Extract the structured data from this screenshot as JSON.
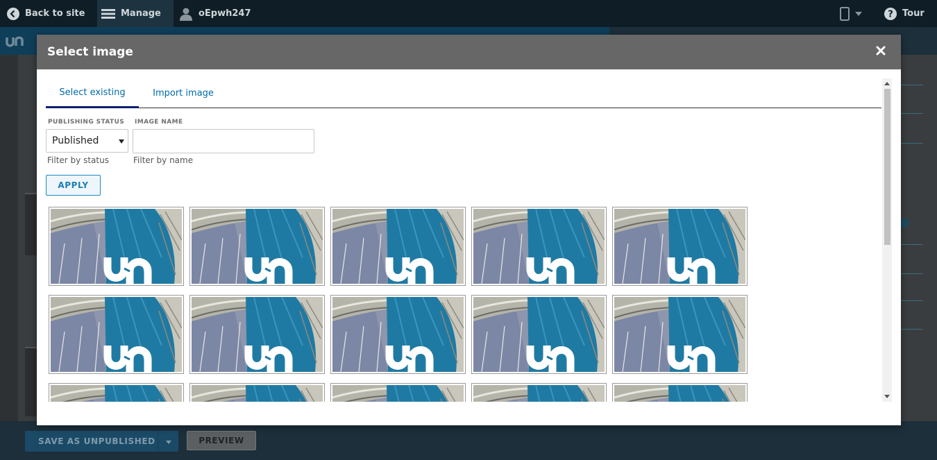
{
  "toolbar": {
    "back_label": "Back to site",
    "manage_label": "Manage",
    "user_label": "oEpwh247",
    "tour_label": "Tour"
  },
  "modal": {
    "title": "Select image",
    "tabs": [
      {
        "label": "Select existing",
        "active": true
      },
      {
        "label": "Import image",
        "active": false
      }
    ],
    "filters": {
      "status_label": "PUBLISHING STATUS",
      "status_value": "Published",
      "status_help": "Filter by status",
      "name_label": "IMAGE NAME",
      "name_value": "",
      "name_help": "Filter by name",
      "apply_label": "APPLY"
    }
  },
  "footer": {
    "save_label": "SAVE AS UNPUBLISHED",
    "preview_label": "PREVIEW"
  },
  "colors": {
    "toolbar_bg": "#0f1e26",
    "modal_header_bg": "#676767",
    "link_blue": "#006ba6",
    "tab_active_underline": "#0c1f73"
  }
}
